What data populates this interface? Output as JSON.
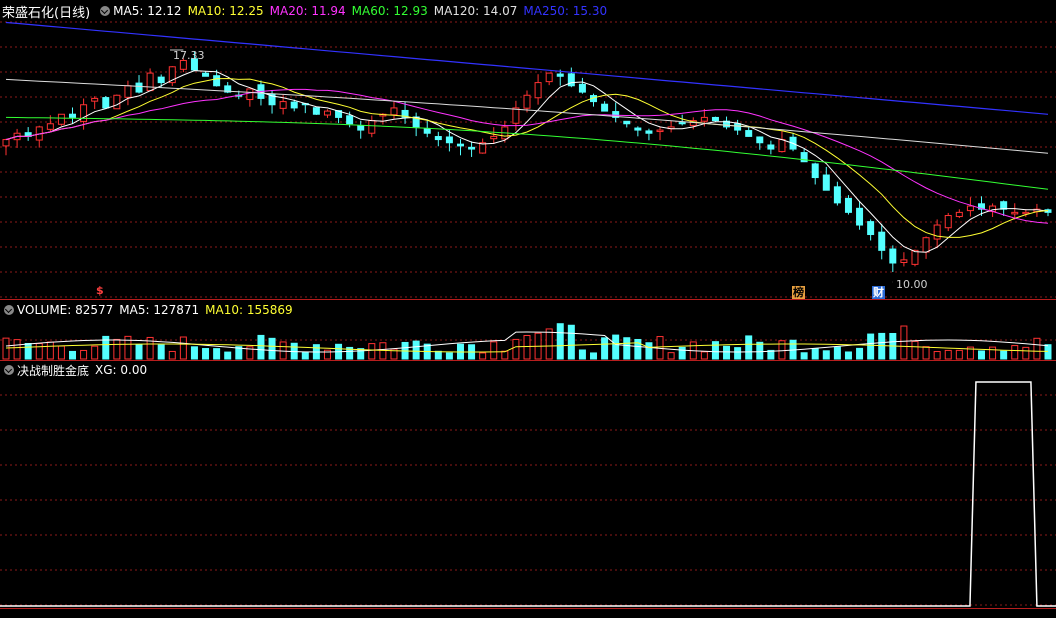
{
  "main": {
    "title": "荣盛石化(日线)",
    "indicators": [
      {
        "label": "MA5: 12.12",
        "color": "#ffffff"
      },
      {
        "label": "MA10: 12.25",
        "color": "#ffff33"
      },
      {
        "label": "MA20: 11.94",
        "color": "#ff33ff"
      },
      {
        "label": "MA60: 12.93",
        "color": "#33ff33"
      },
      {
        "label": "MA120: 14.07",
        "color": "#e0e0e0"
      },
      {
        "label": "MA250: 15.30",
        "color": "#3333ff"
      }
    ],
    "high_label": "17.33",
    "low_label": "10.00",
    "markers": {
      "dollar": "$",
      "bang": "榜",
      "cai": "财"
    }
  },
  "volume": {
    "indicators": [
      {
        "label": "VOLUME: 82577",
        "color": "#ffffff"
      },
      {
        "label": "MA5: 127871",
        "color": "#ffffff"
      },
      {
        "label": "MA10: 155869",
        "color": "#ffff33"
      }
    ]
  },
  "signal": {
    "indicators": [
      {
        "label": "决战制胜金底",
        "color": "#ffffff"
      },
      {
        "label": "XG: 0.00",
        "color": "#ffffff"
      }
    ]
  },
  "chart_data": {
    "type": "candlestick",
    "price_range": [
      10.0,
      17.33
    ],
    "colors": {
      "up": "#ff3232",
      "down": "#54ffff",
      "ma5": "#ffffff",
      "ma10": "#ffff33",
      "ma20": "#ff33ff",
      "ma60": "#33ff33",
      "ma120": "#dcdcdc",
      "ma250": "#3232ff",
      "grid": "#8b1a1a"
    },
    "closes": [
      14.5,
      14.7,
      14.6,
      14.9,
      15.0,
      15.3,
      15.2,
      15.6,
      15.8,
      15.5,
      15.9,
      16.2,
      16.0,
      16.6,
      16.3,
      16.8,
      17.0,
      16.7,
      16.5,
      16.2,
      16.0,
      15.9,
      16.1,
      15.8,
      15.6,
      15.7,
      15.5,
      15.6,
      15.3,
      15.4,
      15.2,
      15.0,
      14.8,
      15.1,
      15.3,
      15.5,
      15.2,
      14.9,
      14.7,
      14.5,
      14.4,
      14.3,
      14.2,
      14.4,
      14.6,
      14.9,
      15.5,
      15.9,
      16.3,
      16.6,
      16.5,
      16.2,
      16.0,
      15.7,
      15.4,
      15.2,
      15.0,
      14.8,
      14.7,
      14.8,
      14.9,
      15.0,
      15.1,
      15.2,
      15.1,
      14.9,
      14.8,
      14.6,
      14.4,
      14.2,
      14.5,
      14.2,
      13.8,
      13.3,
      12.9,
      12.5,
      12.2,
      11.8,
      11.5,
      11.0,
      10.6,
      10.7,
      11.0,
      11.4,
      11.8,
      12.1,
      12.2,
      12.4,
      12.3,
      12.4,
      12.3,
      12.2,
      12.2,
      12.3,
      12.2
    ],
    "ma_values": {
      "ma5": 12.12,
      "ma10": 12.25,
      "ma20": 11.94,
      "ma60": 12.93,
      "ma120": 14.07,
      "ma250": 15.3
    },
    "xg_signal": {
      "start_index": 87.5,
      "end_index": 93,
      "value": 1
    }
  }
}
